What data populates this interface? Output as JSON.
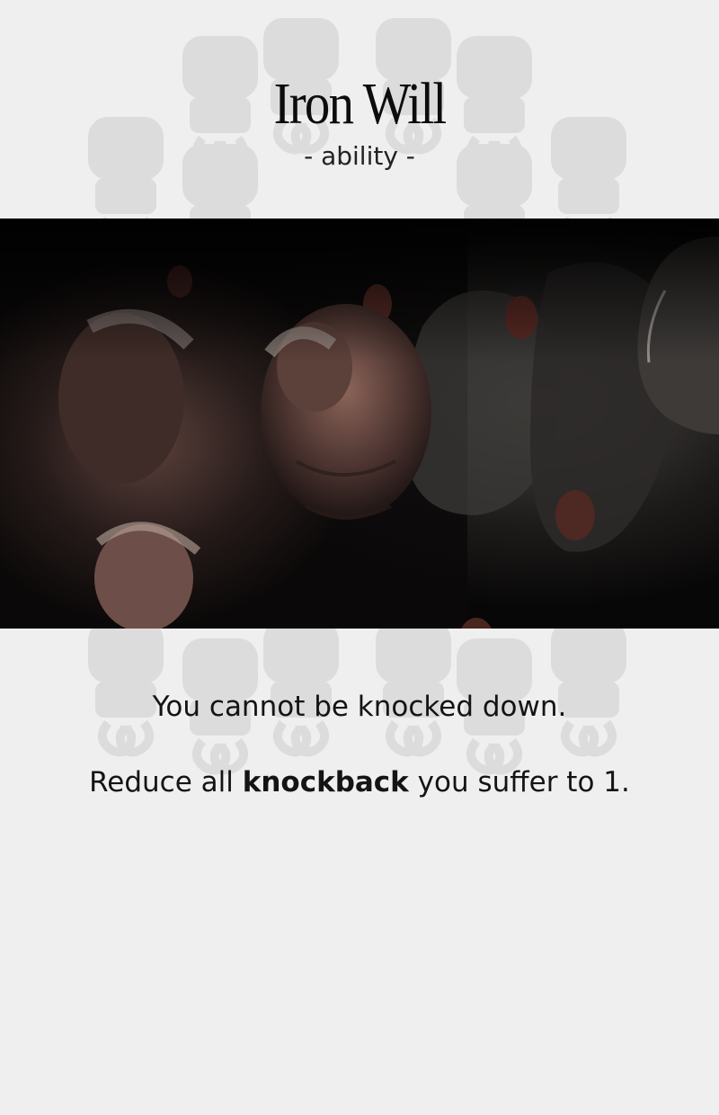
{
  "card": {
    "title": "Iron Will",
    "type_label": "- ability -",
    "art_description_icon": "painting-icon",
    "rules": {
      "line1": "You cannot be knocked down.",
      "line2_prefix": "Reduce all ",
      "line2_keyword": "knockback",
      "line2_suffix": " you suffer to 1."
    }
  },
  "colors": {
    "background": "#efefef",
    "watermark": "#d9d9d9",
    "text": "#111111",
    "art_dark": "#0a0808"
  }
}
